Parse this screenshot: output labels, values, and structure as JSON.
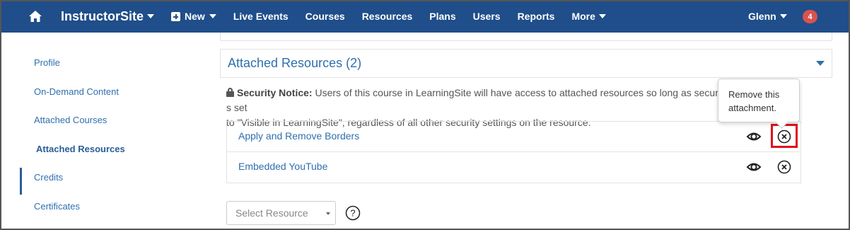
{
  "nav": {
    "brand": "InstructorSite",
    "new_label": "New",
    "items": [
      "Live Events",
      "Courses",
      "Resources",
      "Plans",
      "Users",
      "Reports"
    ],
    "more_label": "More",
    "user": "Glenn",
    "notifications": "4"
  },
  "sidebar": {
    "items": [
      {
        "label": "Profile"
      },
      {
        "label": "On-Demand Content"
      },
      {
        "label": "Attached Courses"
      },
      {
        "label": "Attached Resources"
      },
      {
        "label": "Credits"
      },
      {
        "label": "Certificates"
      }
    ]
  },
  "section": {
    "title": "Attached Resources (2)"
  },
  "notice": {
    "label": "Security Notice:",
    "text": "Users of this course in LearningSite will have access to attached resources so long as security ... is set to \"Visible in LearningSite\", regardless of all other security settings on the resource.",
    "line1": "Users of this course in LearningSite will have access to attached resources so long as securit",
    "line1_tail": "s set",
    "line2": "to \"Visible in LearningSite\", regardless of all other security settings on the resource."
  },
  "resources": [
    {
      "name": "Apply and Remove Borders"
    },
    {
      "name": "Embedded YouTube"
    }
  ],
  "tooltip": {
    "line1": "Remove this",
    "line2": "attachment."
  },
  "select": {
    "placeholder": "Select Resource"
  },
  "colors": {
    "nav_bg": "#1f4e8a",
    "link": "#2f6fad",
    "badge": "#d9534f",
    "highlight": "#e0101a"
  }
}
